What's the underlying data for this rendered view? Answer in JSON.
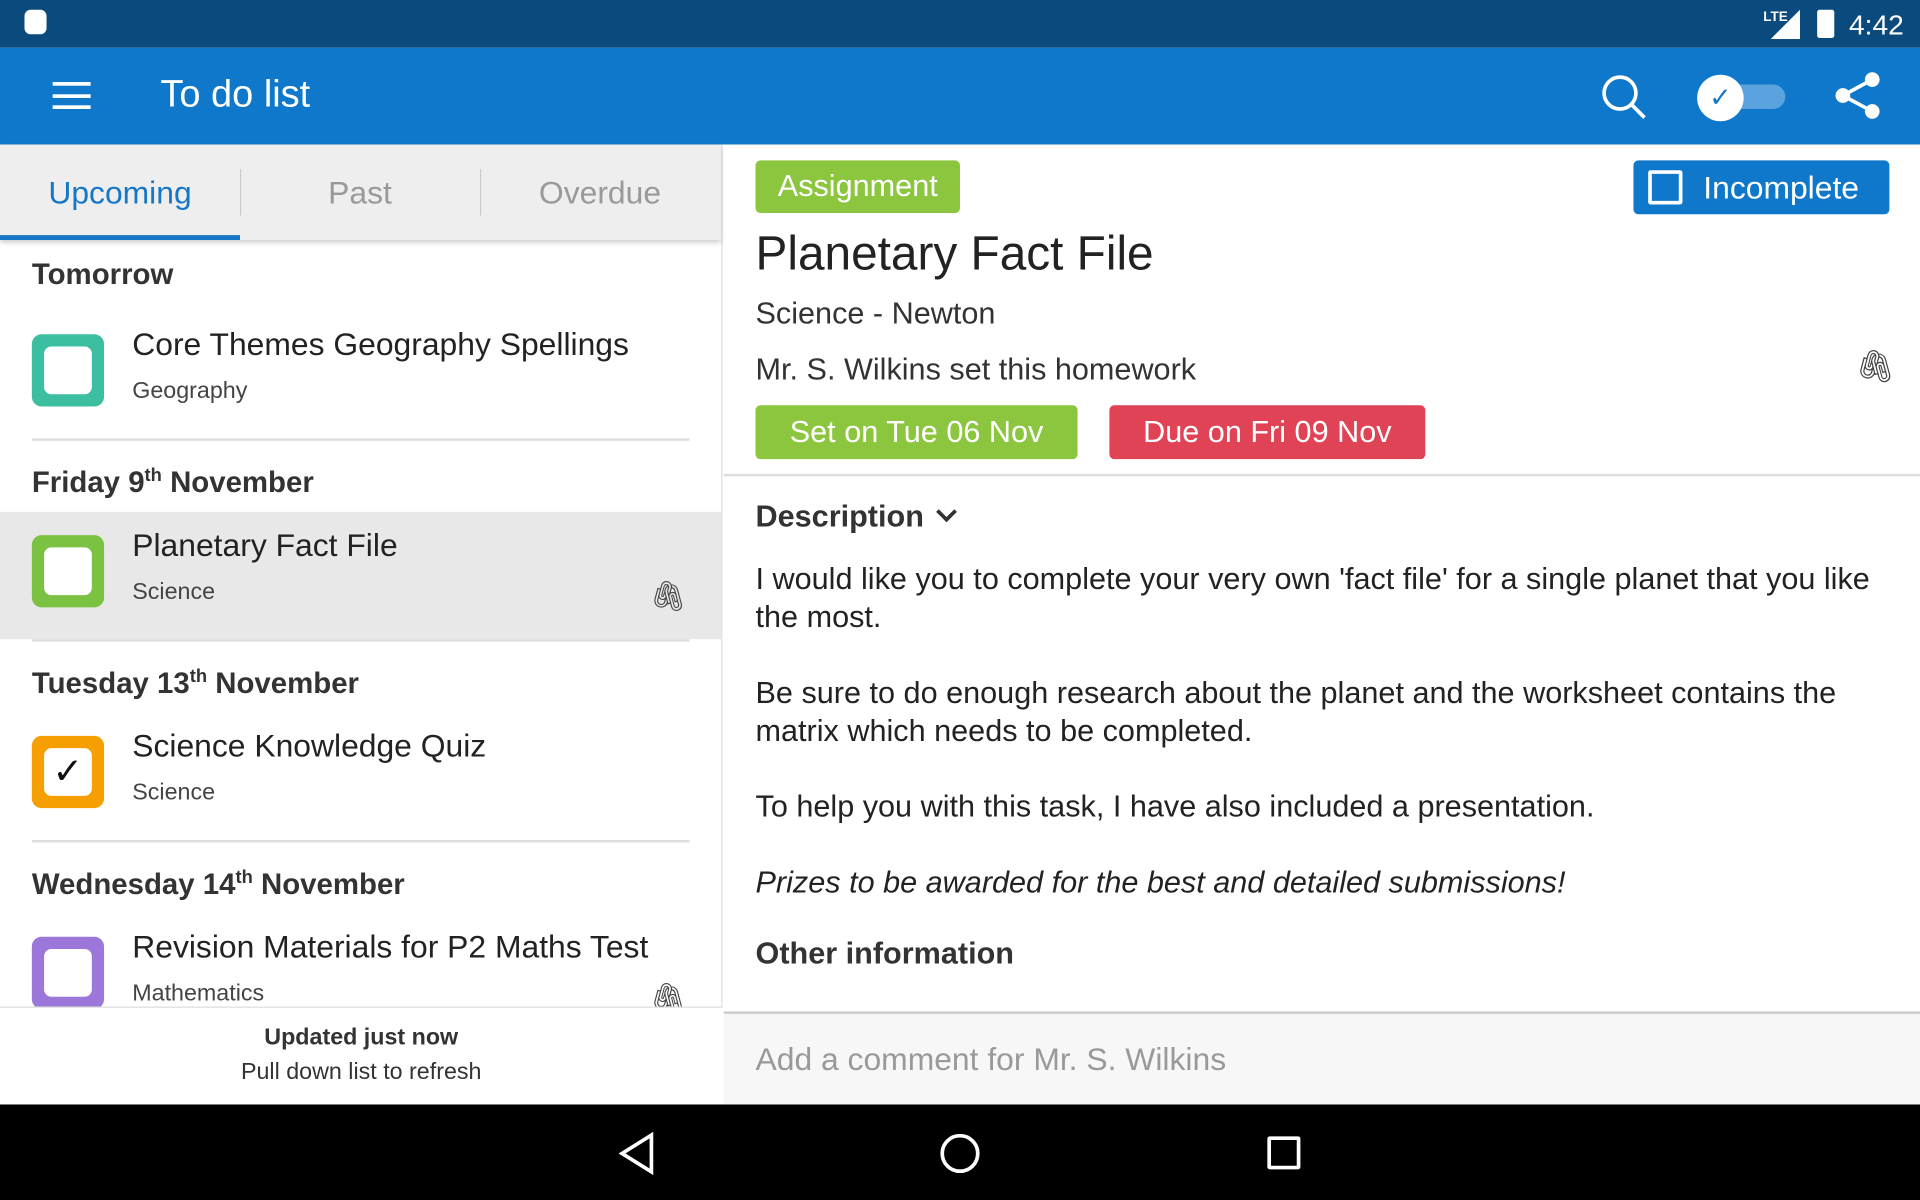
{
  "status": {
    "time": "4:42",
    "network": "LTE"
  },
  "appbar": {
    "title": "To do list",
    "icons": [
      "menu-icon",
      "search-icon",
      "toggle-icon",
      "share-icon"
    ]
  },
  "tabs": [
    "Upcoming",
    "Past",
    "Overdue"
  ],
  "groups": [
    {
      "label": "Tomorrow",
      "items": [
        {
          "title": "Core Themes Geography Spellings",
          "subject": "Geography",
          "color": "#3cbfa0",
          "checked": false,
          "attachment": false
        }
      ]
    },
    {
      "label": "Friday 9",
      "sup": "th",
      "rest": " November",
      "items": [
        {
          "title": "Planetary Fact File",
          "subject": "Science",
          "color": "#7cc242",
          "checked": false,
          "attachment": true
        }
      ]
    },
    {
      "label": "Tuesday 13",
      "sup": "th",
      "rest": " November",
      "items": [
        {
          "title": "Science Knowledge Quiz",
          "subject": "Science",
          "color": "#f5a000",
          "checked": true,
          "attachment": false
        }
      ]
    },
    {
      "label": "Wednesday 14",
      "sup": "th",
      "rest": " November",
      "items": [
        {
          "title": "Revision Materials for P2 Maths Test",
          "subject": "Mathematics",
          "color": "#9a77d8",
          "checked": false,
          "attachment": true
        }
      ]
    }
  ],
  "footer": {
    "updated": "Updated just now",
    "hint": "Pull down list to refresh"
  },
  "detail": {
    "type": "Assignment",
    "status": "Incomplete",
    "title": "Planetary Fact File",
    "class": "Science - Newton",
    "teacher": "Mr. S. Wilkins set this homework",
    "set": "Set on Tue 06 Nov",
    "due": "Due on Fri 09 Nov",
    "description_label": "Description",
    "paragraphs": [
      "I would like you to complete your very own 'fact file' for a single planet that you like the most.",
      "Be sure to do enough research about the planet and the worksheet contains the matrix which needs to be completed.",
      "To help you with this task, I have also included a presentation."
    ],
    "italic": "Prizes to be awarded for the best and detailed submissions!",
    "other_label": "Other information",
    "comment_placeholder": "Add a comment for Mr. S. Wilkins"
  },
  "colors": {
    "appbar": "#0f78ca",
    "statusbar": "#0b4a7c",
    "assignment": "#8cc63f",
    "due": "#e04355",
    "accent": "#1677c7"
  }
}
